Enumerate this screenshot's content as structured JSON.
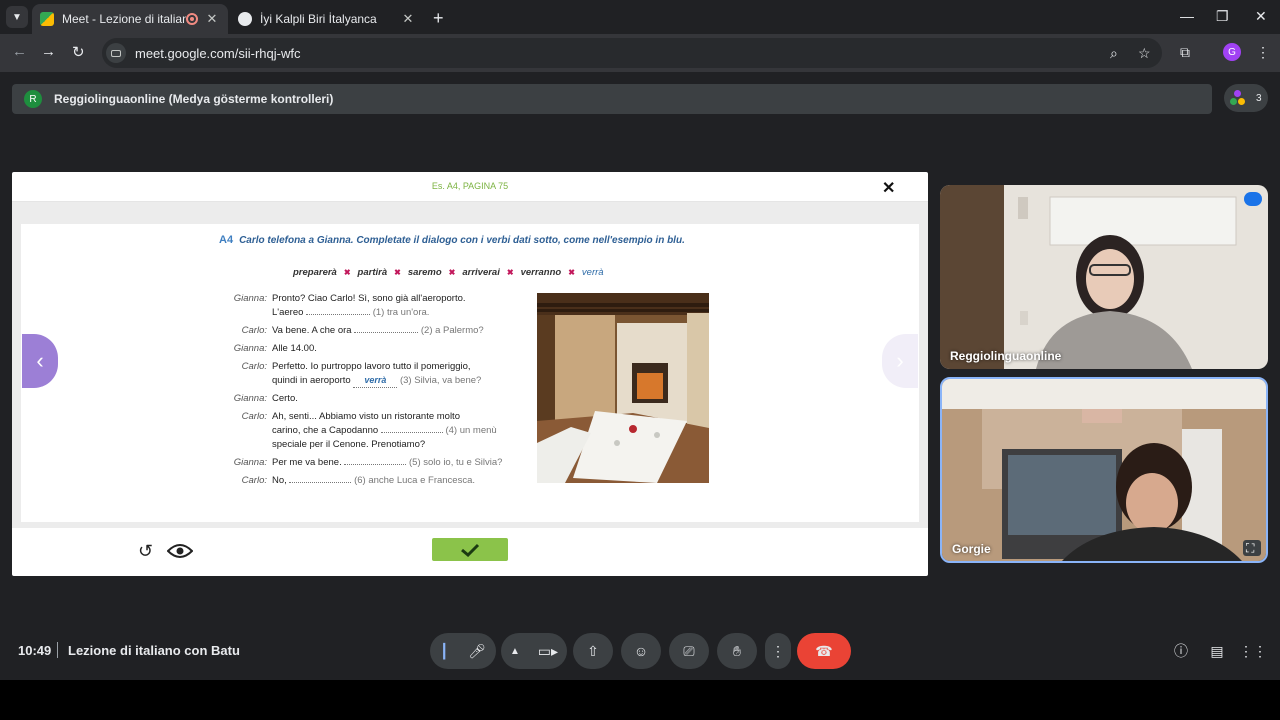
{
  "browser": {
    "tabs": [
      {
        "title": "Meet - Lezione di italiano c",
        "active": true
      },
      {
        "title": "İyi Kalpli Biri İtalyanca",
        "active": false
      }
    ],
    "url": "meet.google.com/sii-rhqj-wfc",
    "profile_initial": "G"
  },
  "meet": {
    "presenter_initial": "R",
    "presenter_banner": "Reggiolinguaonline (Medya gösterme kontrolleri)",
    "participant_count": "3",
    "time": "10:49",
    "meeting_name": "Lezione di italiano con Batu",
    "participants": [
      {
        "name": "Reggiolinguaonline"
      },
      {
        "name": "Gorgie"
      }
    ]
  },
  "shared": {
    "title": "Es. A4, PAGINA 75",
    "exercise_code": "A4",
    "instruction": "Carlo telefona a Gianna. Completate il dialogo con i verbi dati sotto, come nell'esempio in blu.",
    "verbs": [
      "preparerà",
      "partirà",
      "saremo",
      "arriverai",
      "verranno",
      "verrà"
    ],
    "dialogue": [
      {
        "speaker": "Gianna:",
        "lines": [
          "Pronto? Ciao Carlo! Sì, sono già all'aeroporto.",
          "L'aereo",
          "(1) tra un'ora."
        ]
      },
      {
        "speaker": "Carlo:",
        "lines": [
          "Va bene. A che ora",
          "(2) a Palermo?"
        ]
      },
      {
        "speaker": "Gianna:",
        "lines": [
          "Alle 14.00."
        ]
      },
      {
        "speaker": "Carlo:",
        "lines": [
          "Perfetto. Io purtroppo lavoro tutto il pomeriggio,",
          "quindi in aeroporto",
          "verrà",
          "(3) Silvia, va bene?"
        ]
      },
      {
        "speaker": "Gianna:",
        "lines": [
          "Certo."
        ]
      },
      {
        "speaker": "Carlo:",
        "lines": [
          "Ah, senti... Abbiamo visto un ristorante molto",
          "carino, che a Capodanno",
          "(4) un menù",
          "speciale per il Cenone. Prenotiamo?"
        ]
      },
      {
        "speaker": "Gianna:",
        "lines": [
          "Per me va bene.",
          "(5) solo io, tu e Silvia?"
        ]
      },
      {
        "speaker": "Carlo:",
        "lines": [
          "No,",
          "(6) anche Luca e Francesca."
        ]
      }
    ]
  },
  "colors": {
    "accent_green": "#8bc34a",
    "end_call": "#ea4335",
    "nav_purple": "#9c7fd6"
  }
}
